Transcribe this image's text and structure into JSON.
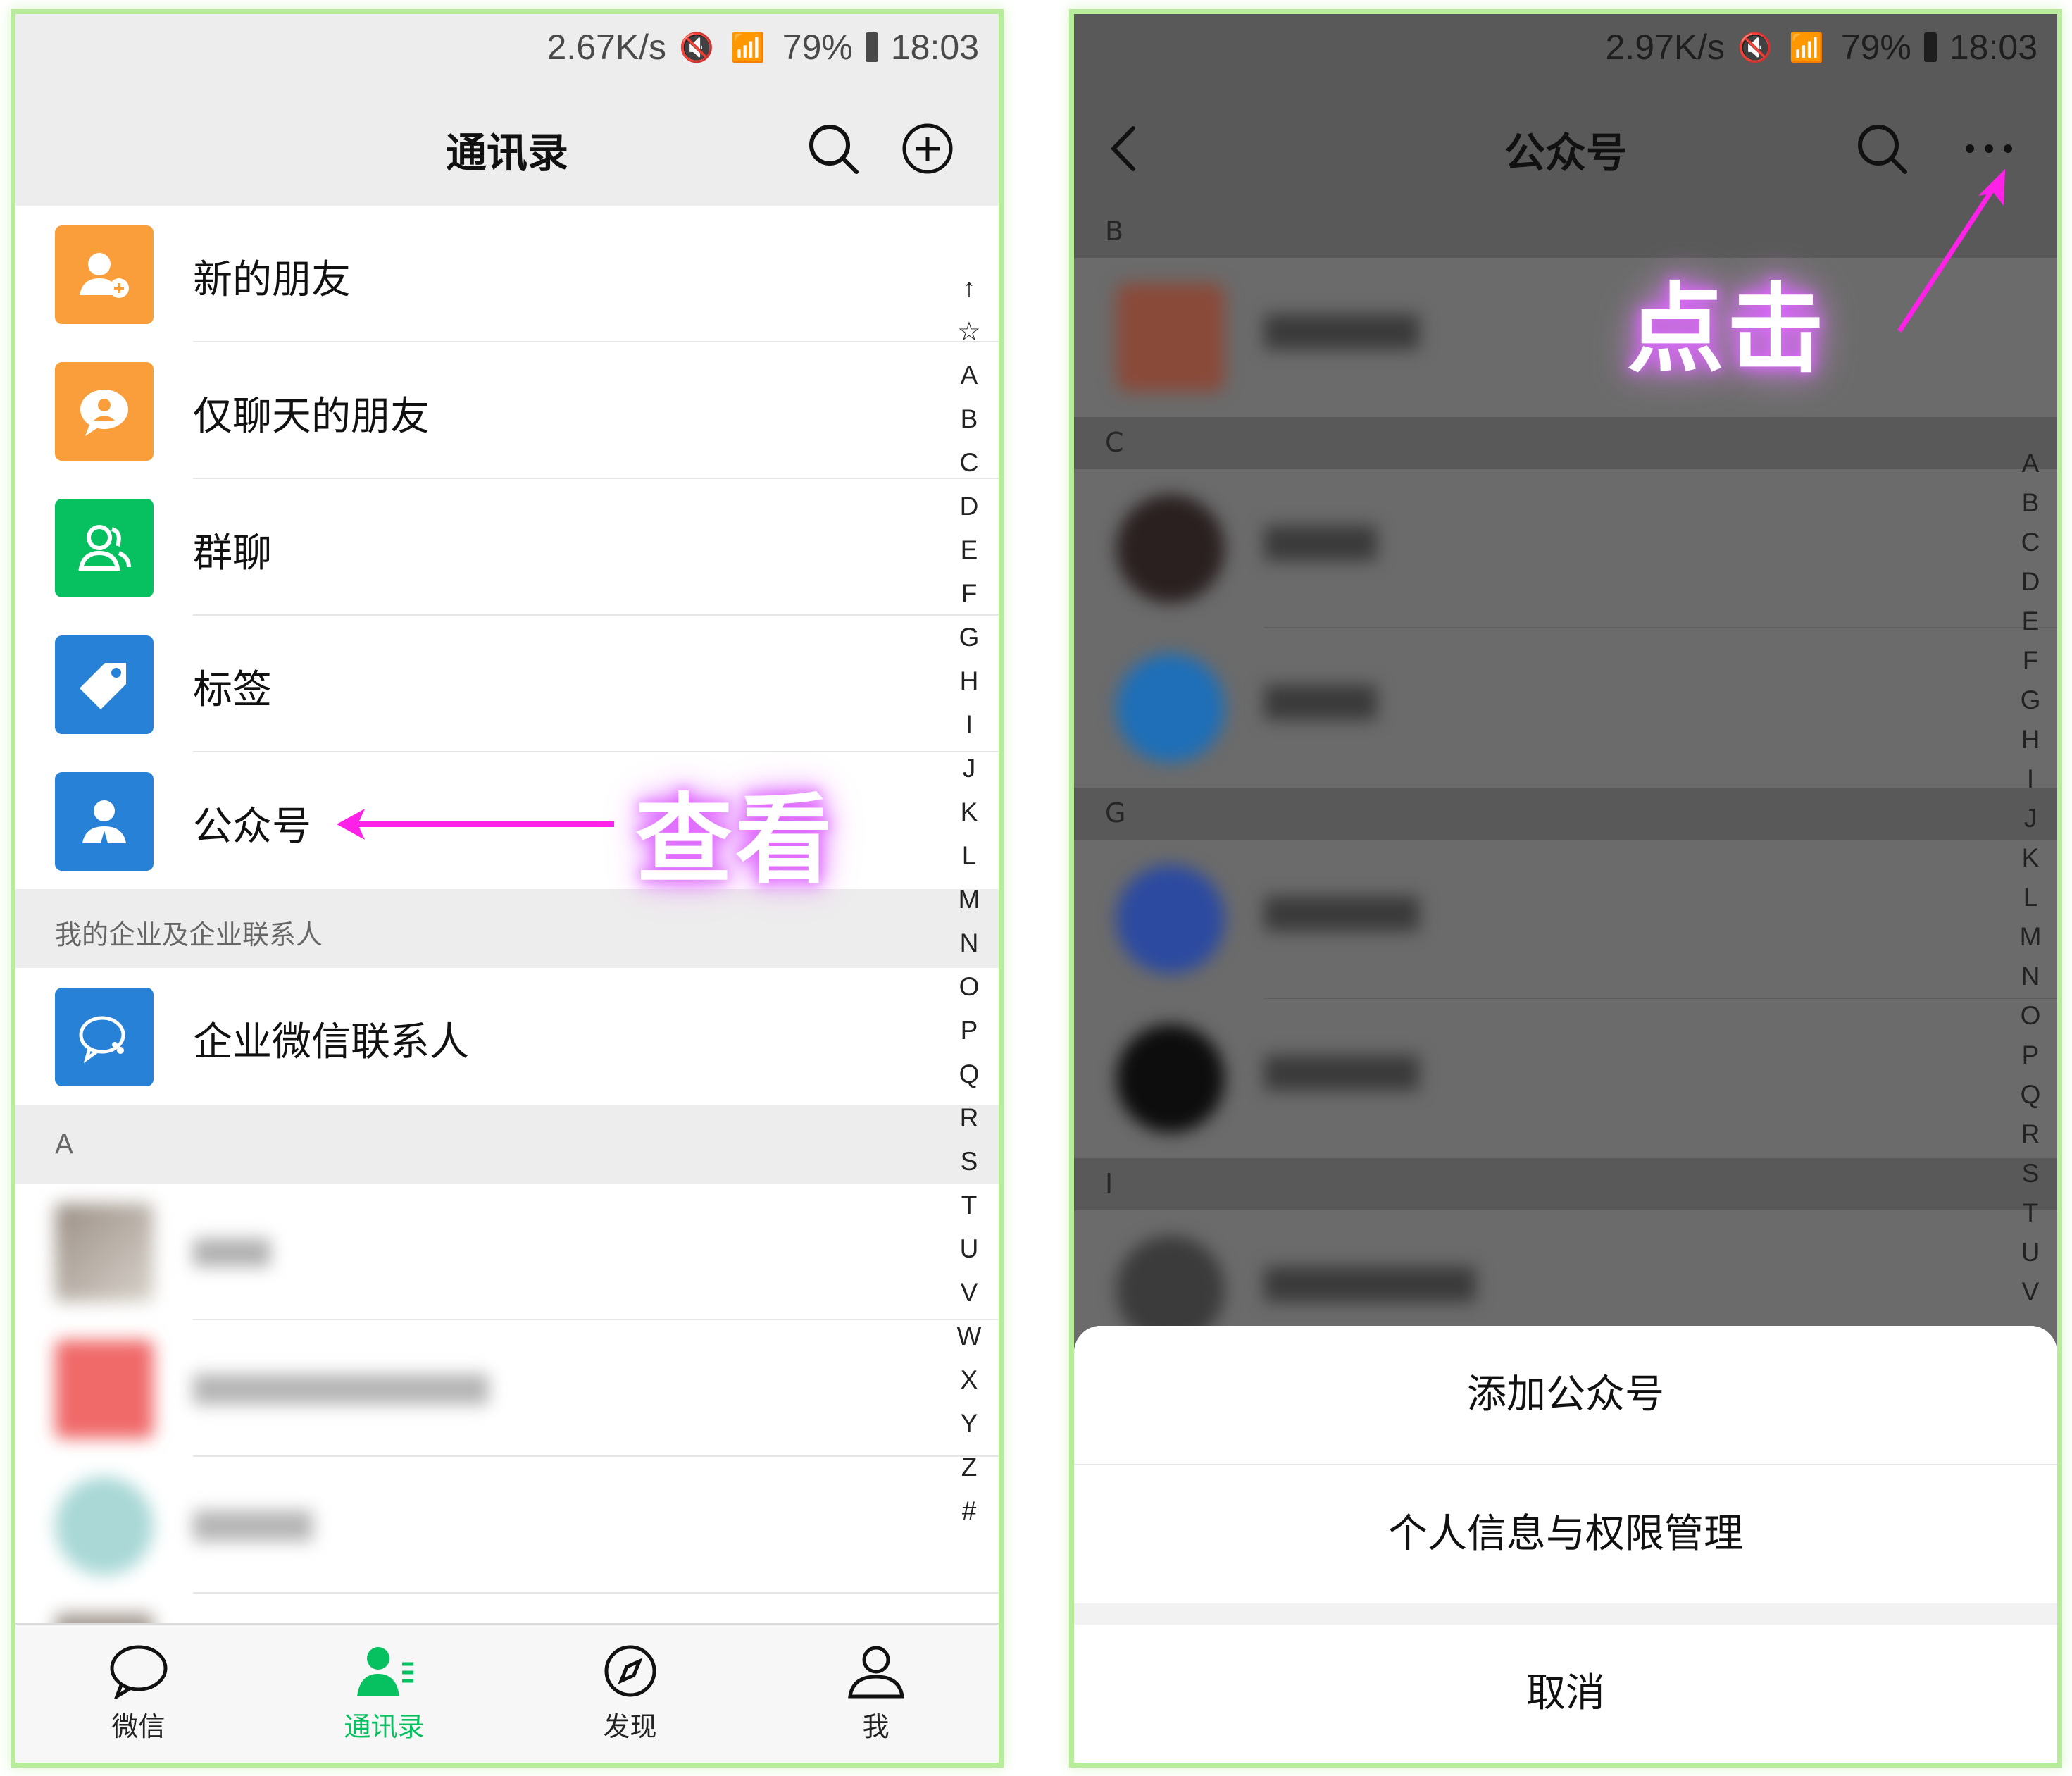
{
  "left_screen": {
    "status": {
      "speed": "2.67K/s",
      "battery": "79%",
      "time": "18:03"
    },
    "title": "通讯录",
    "menu_items": [
      {
        "label": "新的朋友",
        "color": "#fa9d3b",
        "icon": "add-friend-icon"
      },
      {
        "label": "仅聊天的朋友",
        "color": "#fa9d3b",
        "icon": "chat-only-friend-icon"
      },
      {
        "label": "群聊",
        "color": "#07c160",
        "icon": "group-chat-icon"
      },
      {
        "label": "标签",
        "color": "#2782d7",
        "icon": "tag-icon"
      },
      {
        "label": "公众号",
        "color": "#2782d7",
        "icon": "official-account-icon"
      }
    ],
    "enterprise_section": "我的企业及企业联系人",
    "enterprise_item": {
      "label": "企业微信联系人",
      "color": "#2782d7",
      "icon": "wecom-icon"
    },
    "letter_section": "A",
    "index": [
      "↑",
      "☆",
      "A",
      "B",
      "C",
      "D",
      "E",
      "F",
      "G",
      "H",
      "I",
      "J",
      "K",
      "L",
      "M",
      "N",
      "O",
      "P",
      "Q",
      "R",
      "S",
      "T",
      "U",
      "V",
      "W",
      "X",
      "Y",
      "Z",
      "#"
    ],
    "tabs": [
      {
        "label": "微信",
        "icon": "chat-bubble-icon",
        "active": false
      },
      {
        "label": "通讯录",
        "icon": "contacts-icon",
        "active": true
      },
      {
        "label": "发现",
        "icon": "compass-icon",
        "active": false
      },
      {
        "label": "我",
        "icon": "me-icon",
        "active": false
      }
    ],
    "annotation": "查看"
  },
  "right_screen": {
    "status": {
      "speed": "2.97K/s",
      "battery": "79%",
      "time": "18:03"
    },
    "title": "公众号",
    "sections": [
      "B",
      "C",
      "G",
      "I"
    ],
    "index": [
      "A",
      "B",
      "C",
      "D",
      "E",
      "F",
      "G",
      "H",
      "I",
      "J",
      "K",
      "L",
      "M",
      "N",
      "O",
      "P",
      "Q",
      "R",
      "S",
      "T",
      "U",
      "V"
    ],
    "sheet": {
      "add": "添加公众号",
      "privacy": "个人信息与权限管理",
      "cancel": "取消"
    },
    "annotation": "点击"
  },
  "colors": {
    "accent": "#07c160",
    "annotation_arrow": "#ff21e8"
  }
}
